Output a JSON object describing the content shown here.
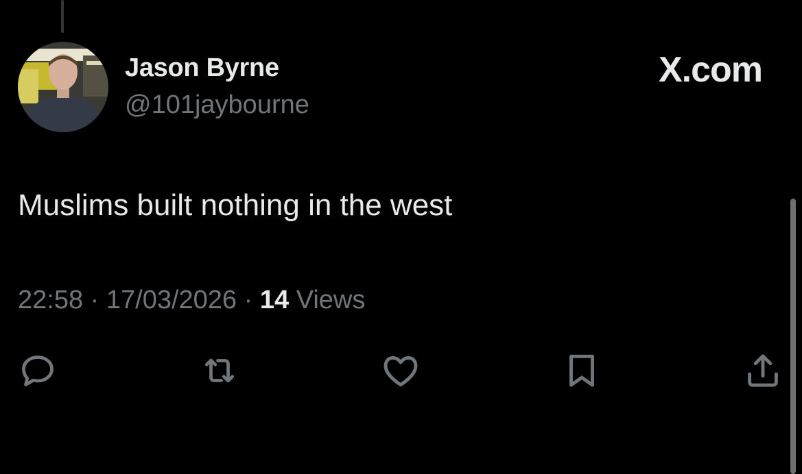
{
  "author": {
    "display_name": "Jason Byrne",
    "handle": "@101jaybourne",
    "avatar": "profile-photo"
  },
  "brand": "X.com",
  "tweet": {
    "text": "Muslims built nothing in the west"
  },
  "meta": {
    "time": "22:58",
    "separator": "·",
    "date": "17/03/2026",
    "views_count": "14",
    "views_label": "Views"
  },
  "actions": [
    {
      "name": "reply",
      "icon": "reply-icon"
    },
    {
      "name": "repost",
      "icon": "repost-icon"
    },
    {
      "name": "like",
      "icon": "like-icon"
    },
    {
      "name": "bookmark",
      "icon": "bookmark-icon"
    },
    {
      "name": "share",
      "icon": "share-icon"
    }
  ],
  "colors": {
    "background": "#000000",
    "primary_text": "#e7e9ea",
    "secondary_text": "#71767b"
  }
}
